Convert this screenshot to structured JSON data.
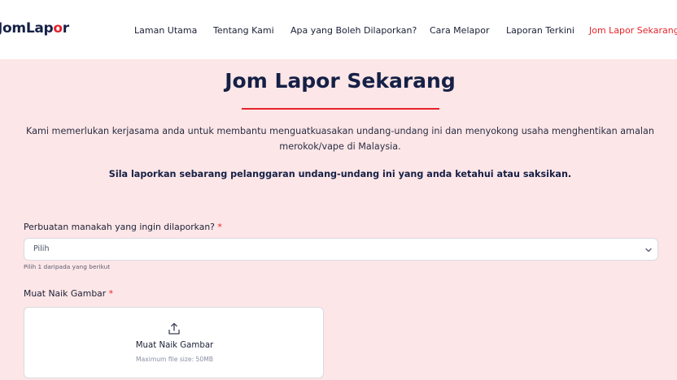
{
  "header": {
    "logo": {
      "part1": "JomLap",
      "accent_mark": "o",
      "part2": "r"
    },
    "nav": [
      {
        "label": "Laman Utama"
      },
      {
        "label": "Tentang Kami"
      },
      {
        "label": "Apa yang Boleh Dilaporkan?"
      },
      {
        "label": "Cara Melapor"
      },
      {
        "label": "Laporan Terkini"
      },
      {
        "label": "Jom Lapor Sekarang",
        "active": true
      }
    ]
  },
  "main": {
    "title": "Jom Lapor Sekarang",
    "intro": "Kami memerlukan kerjasama anda untuk membantu menguatkuasakan undang-undang ini dan menyokong usaha menghentikan amalan merokok/vape di Malaysia.",
    "emphasis": "Sila laporkan sebarang pelanggaran undang-undang ini yang anda ketahui atau saksikan."
  },
  "form": {
    "act_label": "Perbuatan manakah yang ingin dilaporkan?",
    "required_mark": "*",
    "act_select_value": "Pilih",
    "act_hint": "Pilih 1 daripada yang berikut",
    "image_label": "Muat Naik Gambar",
    "upload_title": "Muat Naik Gambar",
    "upload_limit": "Maximum file size: 50MB"
  },
  "colors": {
    "accent": "#e5232a",
    "navy": "#152046",
    "page_background": "#fde6e7"
  },
  "icons": {
    "select_chevron": "chevron-down-icon",
    "upload": "upload-icon"
  }
}
